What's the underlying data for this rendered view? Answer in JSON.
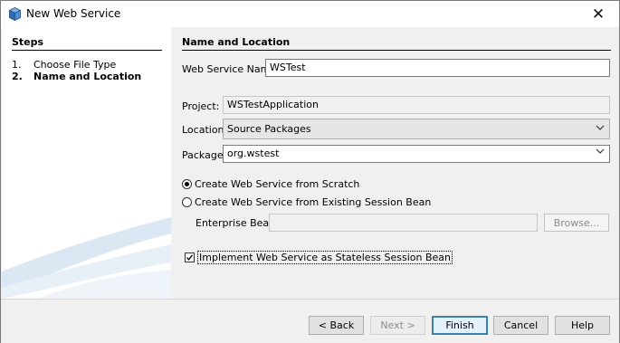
{
  "window": {
    "title": "New Web Service",
    "close_glyph": "✕",
    "icon": "netbeans-cube-icon"
  },
  "steps": {
    "title": "Steps",
    "items": [
      {
        "num": "1.",
        "label": "Choose File Type"
      },
      {
        "num": "2.",
        "label": "Name and Location"
      }
    ]
  },
  "form": {
    "section_title": "Name and Location",
    "web_service_name_label": "Web Service Name:",
    "web_service_name_value": "WSTest",
    "project_label": "Project:",
    "project_value": "WSTestApplication",
    "location_label": "Location:",
    "location_value": "Source Packages",
    "package_label": "Package:",
    "package_value": "org.wstest",
    "radio_scratch_label": "Create Web Service from Scratch",
    "radio_scratch_selected": true,
    "radio_session_label": "Create Web Service from Existing Session Bean",
    "radio_session_selected": false,
    "enterprise_bean_label": "Enterprise Bean:",
    "enterprise_bean_value": "",
    "browse_label": "Browse...",
    "stateless_label": "Implement Web Service as Stateless Session Bean",
    "stateless_checked": true
  },
  "buttons": {
    "back": "< Back",
    "next": "Next >",
    "finish": "Finish",
    "cancel": "Cancel",
    "help": "Help"
  },
  "colors": {
    "default_button_border": "#3c7fb1",
    "swoosh": "#c9dcec"
  }
}
